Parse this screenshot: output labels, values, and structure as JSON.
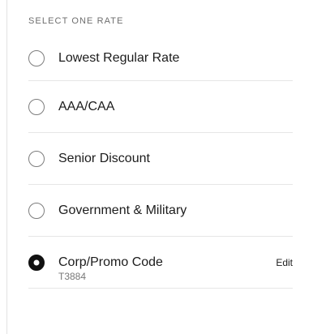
{
  "heading": "SELECT ONE RATE",
  "rates": [
    {
      "label": "Lowest Regular Rate",
      "selected": false
    },
    {
      "label": "AAA/CAA",
      "selected": false
    },
    {
      "label": "Senior Discount",
      "selected": false
    },
    {
      "label": "Government & Military",
      "selected": false
    },
    {
      "label": "Corp/Promo Code",
      "code": "T3884",
      "edit": "Edit",
      "selected": true
    }
  ],
  "colors": {
    "text": "#1c1c1c",
    "muted": "#6e6e6e",
    "divider": "#e6e6e6",
    "radio_border": "#7d7d7d",
    "radio_selected": "#111111"
  }
}
